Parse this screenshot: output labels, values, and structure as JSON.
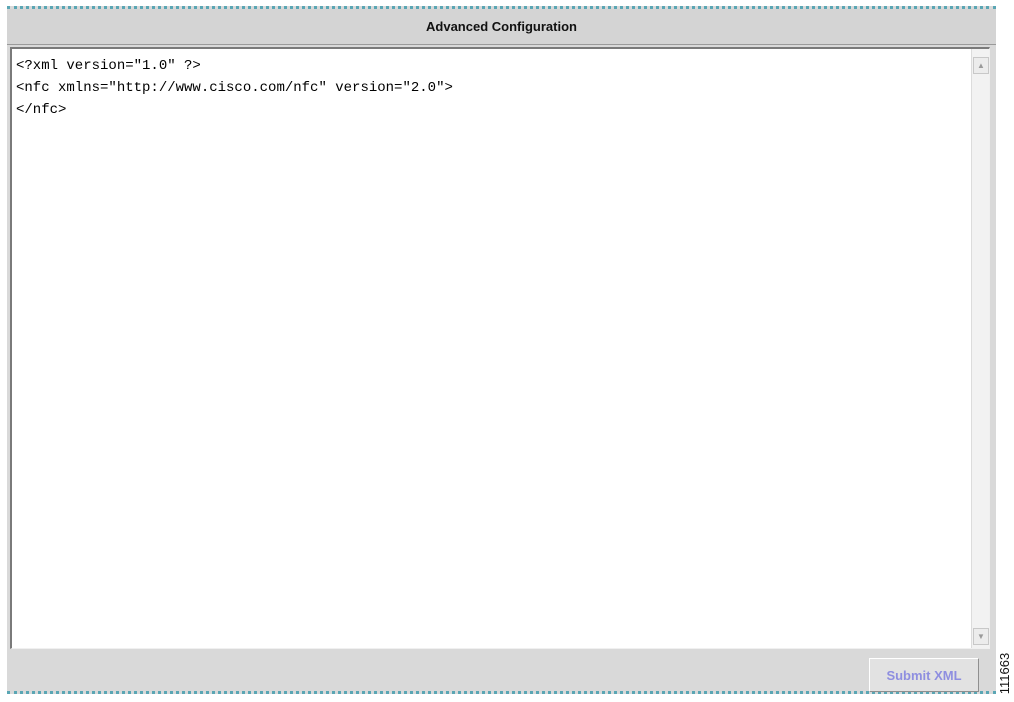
{
  "window": {
    "title": "Advanced Configuration"
  },
  "editor": {
    "content": "<?xml version=\"1.0\" ?>\n<nfc xmlns=\"http://www.cisco.com/nfc\" version=\"2.0\">\n</nfc>"
  },
  "scrollbar": {
    "up_icon": "scroll-up-arrow-icon",
    "down_icon": "scroll-down-arrow-icon",
    "up_glyph": "▲",
    "down_glyph": "▼"
  },
  "footer": {
    "submit_label": "Submit XML"
  },
  "figure_id": "111663",
  "colors": {
    "border_accent": "#5aa6b4",
    "panel_bg": "#d9d9d9",
    "submit_text": "#8e8ee0"
  }
}
